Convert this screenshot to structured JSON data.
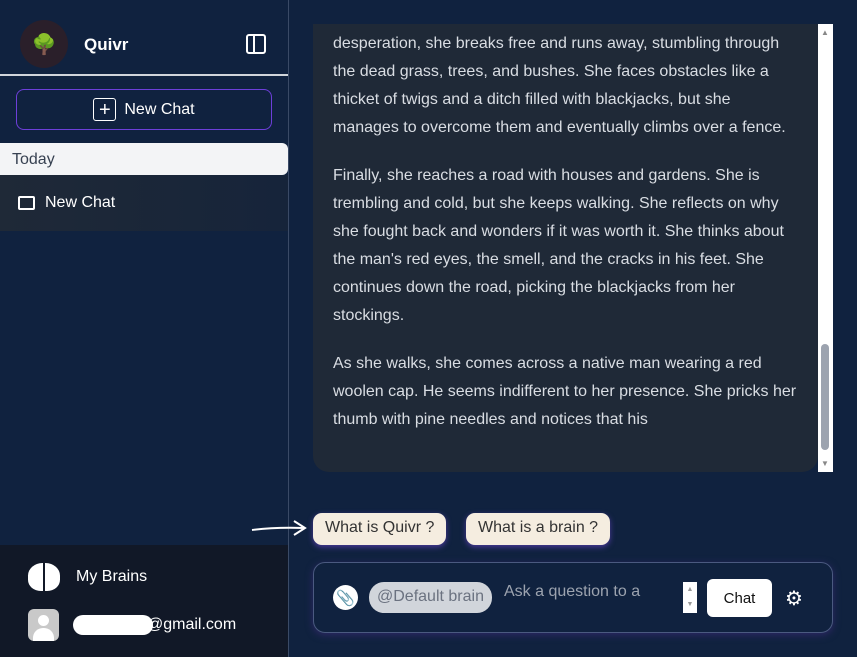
{
  "sidebar": {
    "brand": "Quivr",
    "new_chat_label": "New Chat",
    "section_label": "Today",
    "chats": [
      {
        "label": "New Chat"
      }
    ],
    "my_brains_label": "My Brains",
    "user_email_suffix": "@gmail.com"
  },
  "message": {
    "paragraphs": [
      "desperation, she breaks free and runs away, stumbling through the dead grass, trees, and bushes. She faces obstacles like a thicket of twigs and a ditch filled with blackjacks, but she manages to overcome them and eventually climbs over a fence.",
      "Finally, she reaches a road with houses and gardens. She is trembling and cold, but she keeps walking. She reflects on why she fought back and wonders if it was worth it. She thinks about the man's red eyes, the smell, and the cracks in his feet. She continues down the road, picking the blackjacks from her stockings.",
      "As she walks, she comes across a native man wearing a red woolen cap. He seems indifferent to her presence. She pricks her thumb with pine needles and notices that his"
    ]
  },
  "suggestions": [
    "What is Quivr ?",
    "What is a brain ?"
  ],
  "input": {
    "brain_chip": "@Default brain",
    "placeholder": "Ask a question to a",
    "chat_button": "Chat"
  },
  "colors": {
    "accent": "#6d3fd9",
    "background": "#10223f",
    "bubble": "#1f2937",
    "suggestion": "#f5ede0"
  }
}
